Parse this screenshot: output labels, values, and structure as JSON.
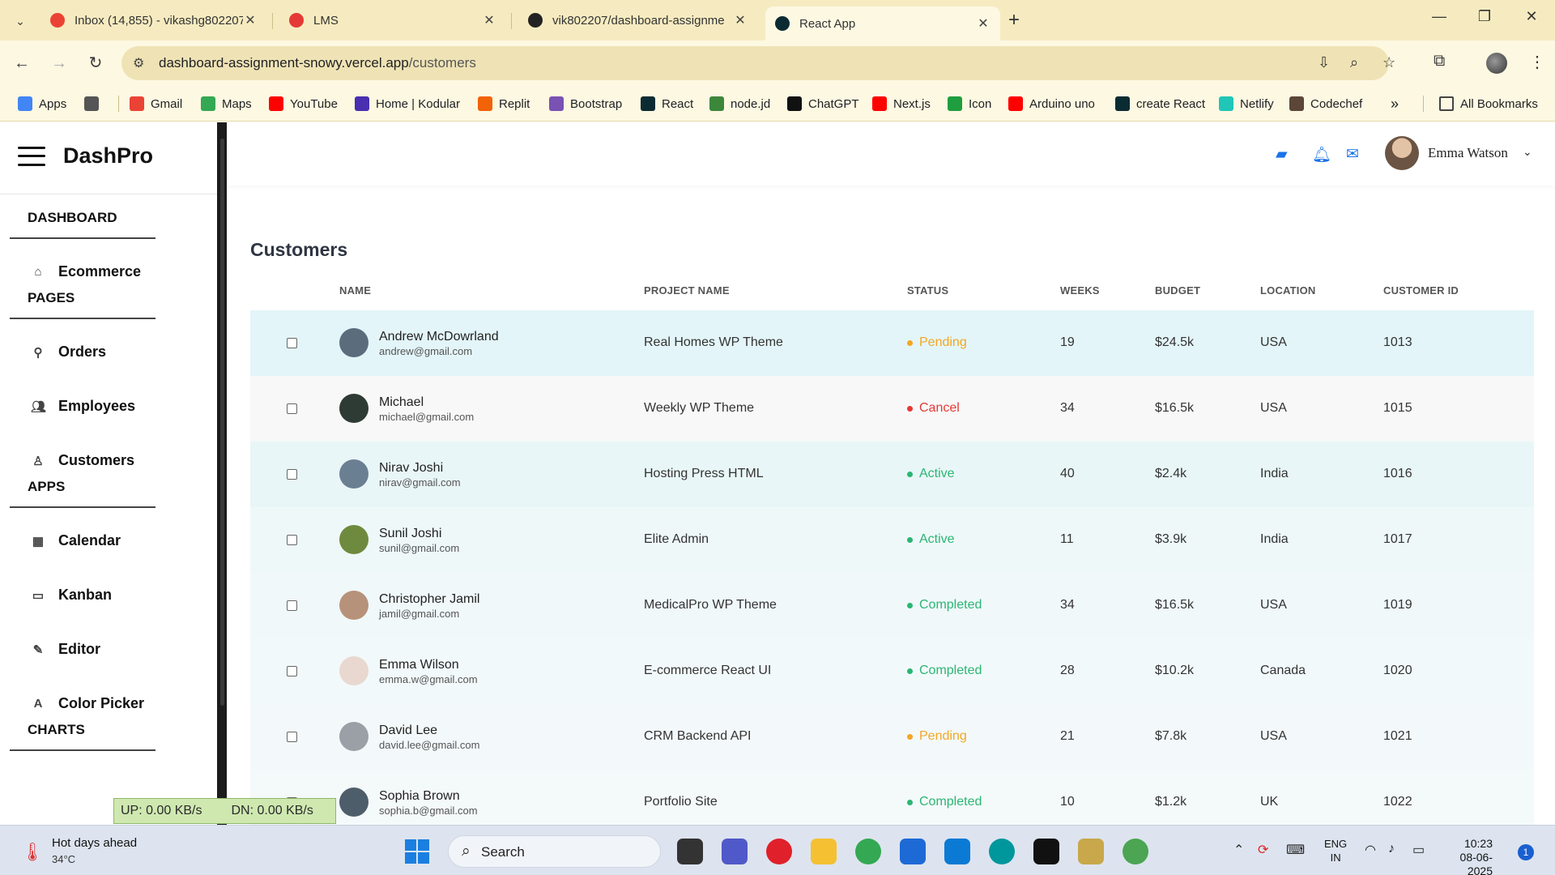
{
  "browser": {
    "tabs": [
      {
        "title": "Inbox (14,855) - vikashg802207",
        "color": "#ea4335"
      },
      {
        "title": "LMS",
        "color": "#e53935"
      },
      {
        "title": "vik802207/dashboard-assignme",
        "color": "#222222"
      },
      {
        "title": "React App",
        "color": "#0b2b33"
      }
    ],
    "url_host": "dashboard-assignment-snowy.vercel.app",
    "url_path": "/customers",
    "bookmarks": [
      {
        "label": "Apps",
        "color": "#4285f4"
      },
      {
        "label": "",
        "color": "#555555"
      },
      {
        "label": "Gmail",
        "color": "#ea4335"
      },
      {
        "label": "Maps",
        "color": "#34a853"
      },
      {
        "label": "YouTube",
        "color": "#ff0000"
      },
      {
        "label": "Home | Kodular",
        "color": "#4a2fb0"
      },
      {
        "label": "Replit",
        "color": "#f26207"
      },
      {
        "label": "Bootstrap",
        "color": "#7952b3"
      },
      {
        "label": "React",
        "color": "#0b2b33"
      },
      {
        "label": "node.jd",
        "color": "#3c873a"
      },
      {
        "label": "ChatGPT",
        "color": "#111111"
      },
      {
        "label": "Next.js",
        "color": "#ff0000"
      },
      {
        "label": "Icon",
        "color": "#1e9e3e"
      },
      {
        "label": "Arduino uno",
        "color": "#ff0000"
      },
      {
        "label": "create React",
        "color": "#0b2b33"
      },
      {
        "label": "Netlify",
        "color": "#20c6b7"
      },
      {
        "label": "Codechef",
        "color": "#5b4638"
      }
    ],
    "all_bookmarks": "All Bookmarks"
  },
  "sidebar": {
    "brand": "DashPro",
    "sections": [
      {
        "title": "DASHBOARD",
        "items": [
          {
            "label": "Ecommerce",
            "icon": "home-icon"
          }
        ]
      },
      {
        "title": "PAGES",
        "items": [
          {
            "label": "Orders",
            "icon": "pin-icon"
          },
          {
            "label": "Employees",
            "icon": "people-icon"
          },
          {
            "label": "Customers",
            "icon": "person-icon"
          }
        ]
      },
      {
        "title": "APPS",
        "items": [
          {
            "label": "Calendar",
            "icon": "calendar-icon"
          },
          {
            "label": "Kanban",
            "icon": "folder-icon"
          },
          {
            "label": "Editor",
            "icon": "pencil-icon"
          },
          {
            "label": "Color Picker",
            "icon": "color-picker-icon"
          }
        ]
      },
      {
        "title": "CHARTS",
        "items": []
      }
    ]
  },
  "header": {
    "user_name": "Emma Watson",
    "accent": "#1a73e8"
  },
  "page": {
    "title": "Customers",
    "columns": [
      "NAME",
      "PROJECT NAME",
      "STATUS",
      "WEEKS",
      "BUDGET",
      "LOCATION",
      "CUSTOMER ID"
    ],
    "customers": [
      {
        "name": "Andrew McDowrland",
        "email": "andrew@gmail.com",
        "project": "Real Homes WP Theme",
        "status": "Pending",
        "status_color": "#f5a623",
        "weeks": "19",
        "budget": "$24.5k",
        "location": "USA",
        "id": "1013"
      },
      {
        "name": "Michael",
        "email": "michael@gmail.com",
        "project": "Weekly WP Theme",
        "status": "Cancel",
        "status_color": "#e53935",
        "weeks": "34",
        "budget": "$16.5k",
        "location": "USA",
        "id": "1015"
      },
      {
        "name": "Nirav Joshi",
        "email": "nirav@gmail.com",
        "project": "Hosting Press HTML",
        "status": "Active",
        "status_color": "#2bb673",
        "weeks": "40",
        "budget": "$2.4k",
        "location": "India",
        "id": "1016"
      },
      {
        "name": "Sunil Joshi",
        "email": "sunil@gmail.com",
        "project": "Elite Admin",
        "status": "Active",
        "status_color": "#2bb673",
        "weeks": "11",
        "budget": "$3.9k",
        "location": "India",
        "id": "1017"
      },
      {
        "name": "Christopher Jamil",
        "email": "jamil@gmail.com",
        "project": "MedicalPro WP Theme",
        "status": "Completed",
        "status_color": "#2bb673",
        "weeks": "34",
        "budget": "$16.5k",
        "location": "USA",
        "id": "1019"
      },
      {
        "name": "Emma Wilson",
        "email": "emma.w@gmail.com",
        "project": "E-commerce React UI",
        "status": "Completed",
        "status_color": "#2bb673",
        "weeks": "28",
        "budget": "$10.2k",
        "location": "Canada",
        "id": "1020"
      },
      {
        "name": "David Lee",
        "email": "david.lee@gmail.com",
        "project": "CRM Backend API",
        "status": "Pending",
        "status_color": "#f5a623",
        "weeks": "21",
        "budget": "$7.8k",
        "location": "USA",
        "id": "1021"
      },
      {
        "name": "Sophia Brown",
        "email": "sophia.b@gmail.com",
        "project": "Portfolio Site",
        "status": "Completed",
        "status_color": "#2bb673",
        "weeks": "10",
        "budget": "$1.2k",
        "location": "UK",
        "id": "1022"
      }
    ]
  },
  "overlay": {
    "up": "UP: 0.00 KB/s",
    "down": "DN: 0.00 KB/s"
  },
  "taskbar": {
    "weather_title": "Hot days ahead",
    "weather_temp": "34°C",
    "search": "Search",
    "lang_1": "ENG",
    "lang_2": "IN",
    "time": "10:23",
    "date": "08-06-2025",
    "notifications": "1"
  }
}
